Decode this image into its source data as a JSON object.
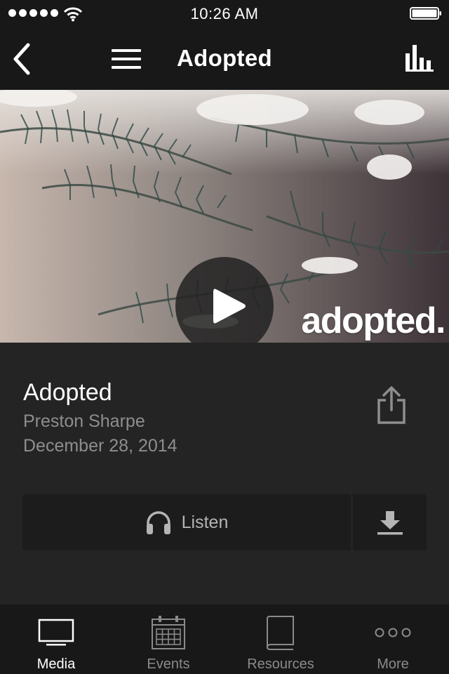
{
  "status_bar": {
    "time": "10:26 AM",
    "signal_icon": "signal-dots-icon",
    "wifi_icon": "wifi-icon",
    "battery_icon": "battery-icon",
    "battery_level": 1.0
  },
  "nav_bar": {
    "title": "Adopted",
    "back_icon": "chevron-left-icon",
    "menu_icon": "hamburger-menu-icon",
    "right_icon": "bar-chart-icon"
  },
  "hero": {
    "wordmark": "adopted.",
    "play_icon": "play-icon"
  },
  "sermon": {
    "title": "Adopted",
    "speaker": "Preston Sharpe",
    "date": "December 28, 2014",
    "share_icon": "share-icon"
  },
  "actions": {
    "listen_label": "Listen",
    "listen_icon": "headphones-icon",
    "download_icon": "download-icon"
  },
  "tab_bar": {
    "tabs": [
      {
        "label": "Media",
        "icon": "tv-icon",
        "active": true
      },
      {
        "label": "Events",
        "icon": "calendar-icon",
        "active": false
      },
      {
        "label": "Resources",
        "icon": "book-icon",
        "active": false
      },
      {
        "label": "More",
        "icon": "more-dots-icon",
        "active": false
      }
    ]
  },
  "colors": {
    "background": "#242424",
    "bars": "#181818",
    "button": "#1c1c1c",
    "secondary_text": "#8e8e8e"
  }
}
